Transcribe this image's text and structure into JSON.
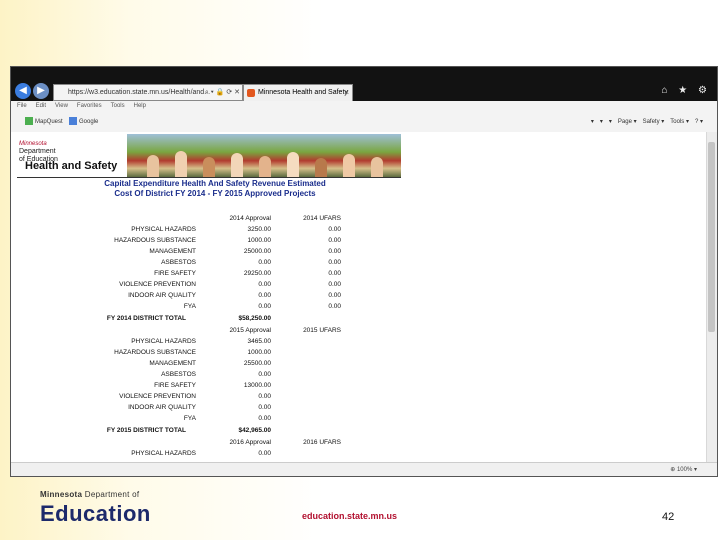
{
  "browser": {
    "url": "https://w3.education.state.mn.us/Health/and...",
    "url_icons": "⌕ ▾ 🔒 ⟳ ✕",
    "tab_title": "Minnesota Health and Safety",
    "tab_close": "×",
    "toolbar_icons": "⌂ ★ ⚙",
    "menu": [
      "File",
      "Edit",
      "View",
      "Favorites",
      "Tools",
      "Help"
    ],
    "favorites": [
      "MapQuest",
      "Google"
    ],
    "commands": [
      "▾",
      "▾",
      "▾",
      "Page ▾",
      "Safety ▾",
      "Tools ▾",
      "? ▾"
    ],
    "zoom": "100%",
    "colors": {
      "titlebar": "#121212",
      "favicon": "#e2571e",
      "title_blue": "#1a2d8c"
    }
  },
  "page_header": {
    "dept_line1": "Minnesota",
    "dept_line2": "Department",
    "dept_line3": "of Education",
    "title": "Health and Safety"
  },
  "report": {
    "title_line1": "Capital Expenditure Health And Safety Revenue Estimated",
    "title_line2": "Cost Of District FY 2014 - FY 2015 Approved Projects",
    "sections": [
      {
        "col1": "2014 Approval",
        "col2": "2014 UFARS",
        "rows": [
          {
            "label": "PHYSICAL HAZARDS",
            "v1": "3250.00",
            "v2": "0.00"
          },
          {
            "label": "HAZARDOUS SUBSTANCE",
            "v1": "1000.00",
            "v2": "0.00"
          },
          {
            "label": "MANAGEMENT",
            "v1": "25000.00",
            "v2": "0.00"
          },
          {
            "label": "ASBESTOS",
            "v1": "0.00",
            "v2": "0.00"
          },
          {
            "label": "FIRE SAFETY",
            "v1": "29250.00",
            "v2": "0.00"
          },
          {
            "label": "VIOLENCE PREVENTION",
            "v1": "0.00",
            "v2": "0.00"
          },
          {
            "label": "INDOOR AIR QUALITY",
            "v1": "0.00",
            "v2": "0.00"
          },
          {
            "label": "FYA",
            "v1": "0.00",
            "v2": "0.00"
          }
        ],
        "total_label": "FY 2014 DISTRICT TOTAL",
        "total": "$58,250.00"
      },
      {
        "col1": "2015 Approval",
        "col2": "2015 UFARS",
        "rows": [
          {
            "label": "PHYSICAL HAZARDS",
            "v1": "3465.00",
            "v2": ""
          },
          {
            "label": "HAZARDOUS SUBSTANCE",
            "v1": "1000.00",
            "v2": ""
          },
          {
            "label": "MANAGEMENT",
            "v1": "25500.00",
            "v2": ""
          },
          {
            "label": "ASBESTOS",
            "v1": "0.00",
            "v2": ""
          },
          {
            "label": "FIRE SAFETY",
            "v1": "13000.00",
            "v2": ""
          },
          {
            "label": "VIOLENCE PREVENTION",
            "v1": "0.00",
            "v2": ""
          },
          {
            "label": "INDOOR AIR QUALITY",
            "v1": "0.00",
            "v2": ""
          },
          {
            "label": "FYA",
            "v1": "0.00",
            "v2": ""
          }
        ],
        "total_label": "FY 2015 DISTRICT TOTAL",
        "total": "$42,965.00"
      },
      {
        "col1": "2016 Approval",
        "col2": "2016 UFARS",
        "rows": [
          {
            "label": "PHYSICAL HAZARDS",
            "v1": "0.00",
            "v2": ""
          }
        ]
      }
    ]
  },
  "footer": {
    "logo_line1_state": "Minnesota",
    "logo_line1_rest": "Department of",
    "logo_line2": "Education",
    "site": "education.state.mn.us",
    "page_number": "42"
  }
}
